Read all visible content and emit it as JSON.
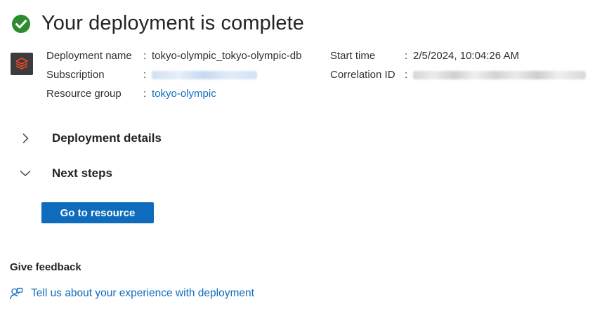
{
  "header": {
    "title": "Your deployment is complete",
    "status_icon": "success-check-icon",
    "status_color": "#2e8b2e"
  },
  "resource_icon": {
    "name": "databricks-icon",
    "color": "#e8472a"
  },
  "details": {
    "deployment_name": {
      "label": "Deployment name",
      "sep": ":",
      "value": "tokyo-olympic_tokyo-olympic-db"
    },
    "subscription": {
      "label": "Subscription",
      "sep": ":"
    },
    "resource_group": {
      "label": "Resource group",
      "sep": ":",
      "value": "tokyo-olympic"
    },
    "start_time": {
      "label": "Start time",
      "sep": ":",
      "value": "2/5/2024, 10:04:26 AM"
    },
    "correlation_id": {
      "label": "Correlation ID",
      "sep": ":"
    }
  },
  "sections": {
    "deployment_details": {
      "label": "Deployment details",
      "expanded": false
    },
    "next_steps": {
      "label": "Next steps",
      "expanded": true
    }
  },
  "actions": {
    "go_to_resource": "Go to resource"
  },
  "feedback": {
    "heading": "Give feedback",
    "link": "Tell us about your experience with deployment",
    "icon": "feedback-person-icon"
  },
  "colors": {
    "accent": "#0f6cbd",
    "success": "#2e8b2e"
  }
}
